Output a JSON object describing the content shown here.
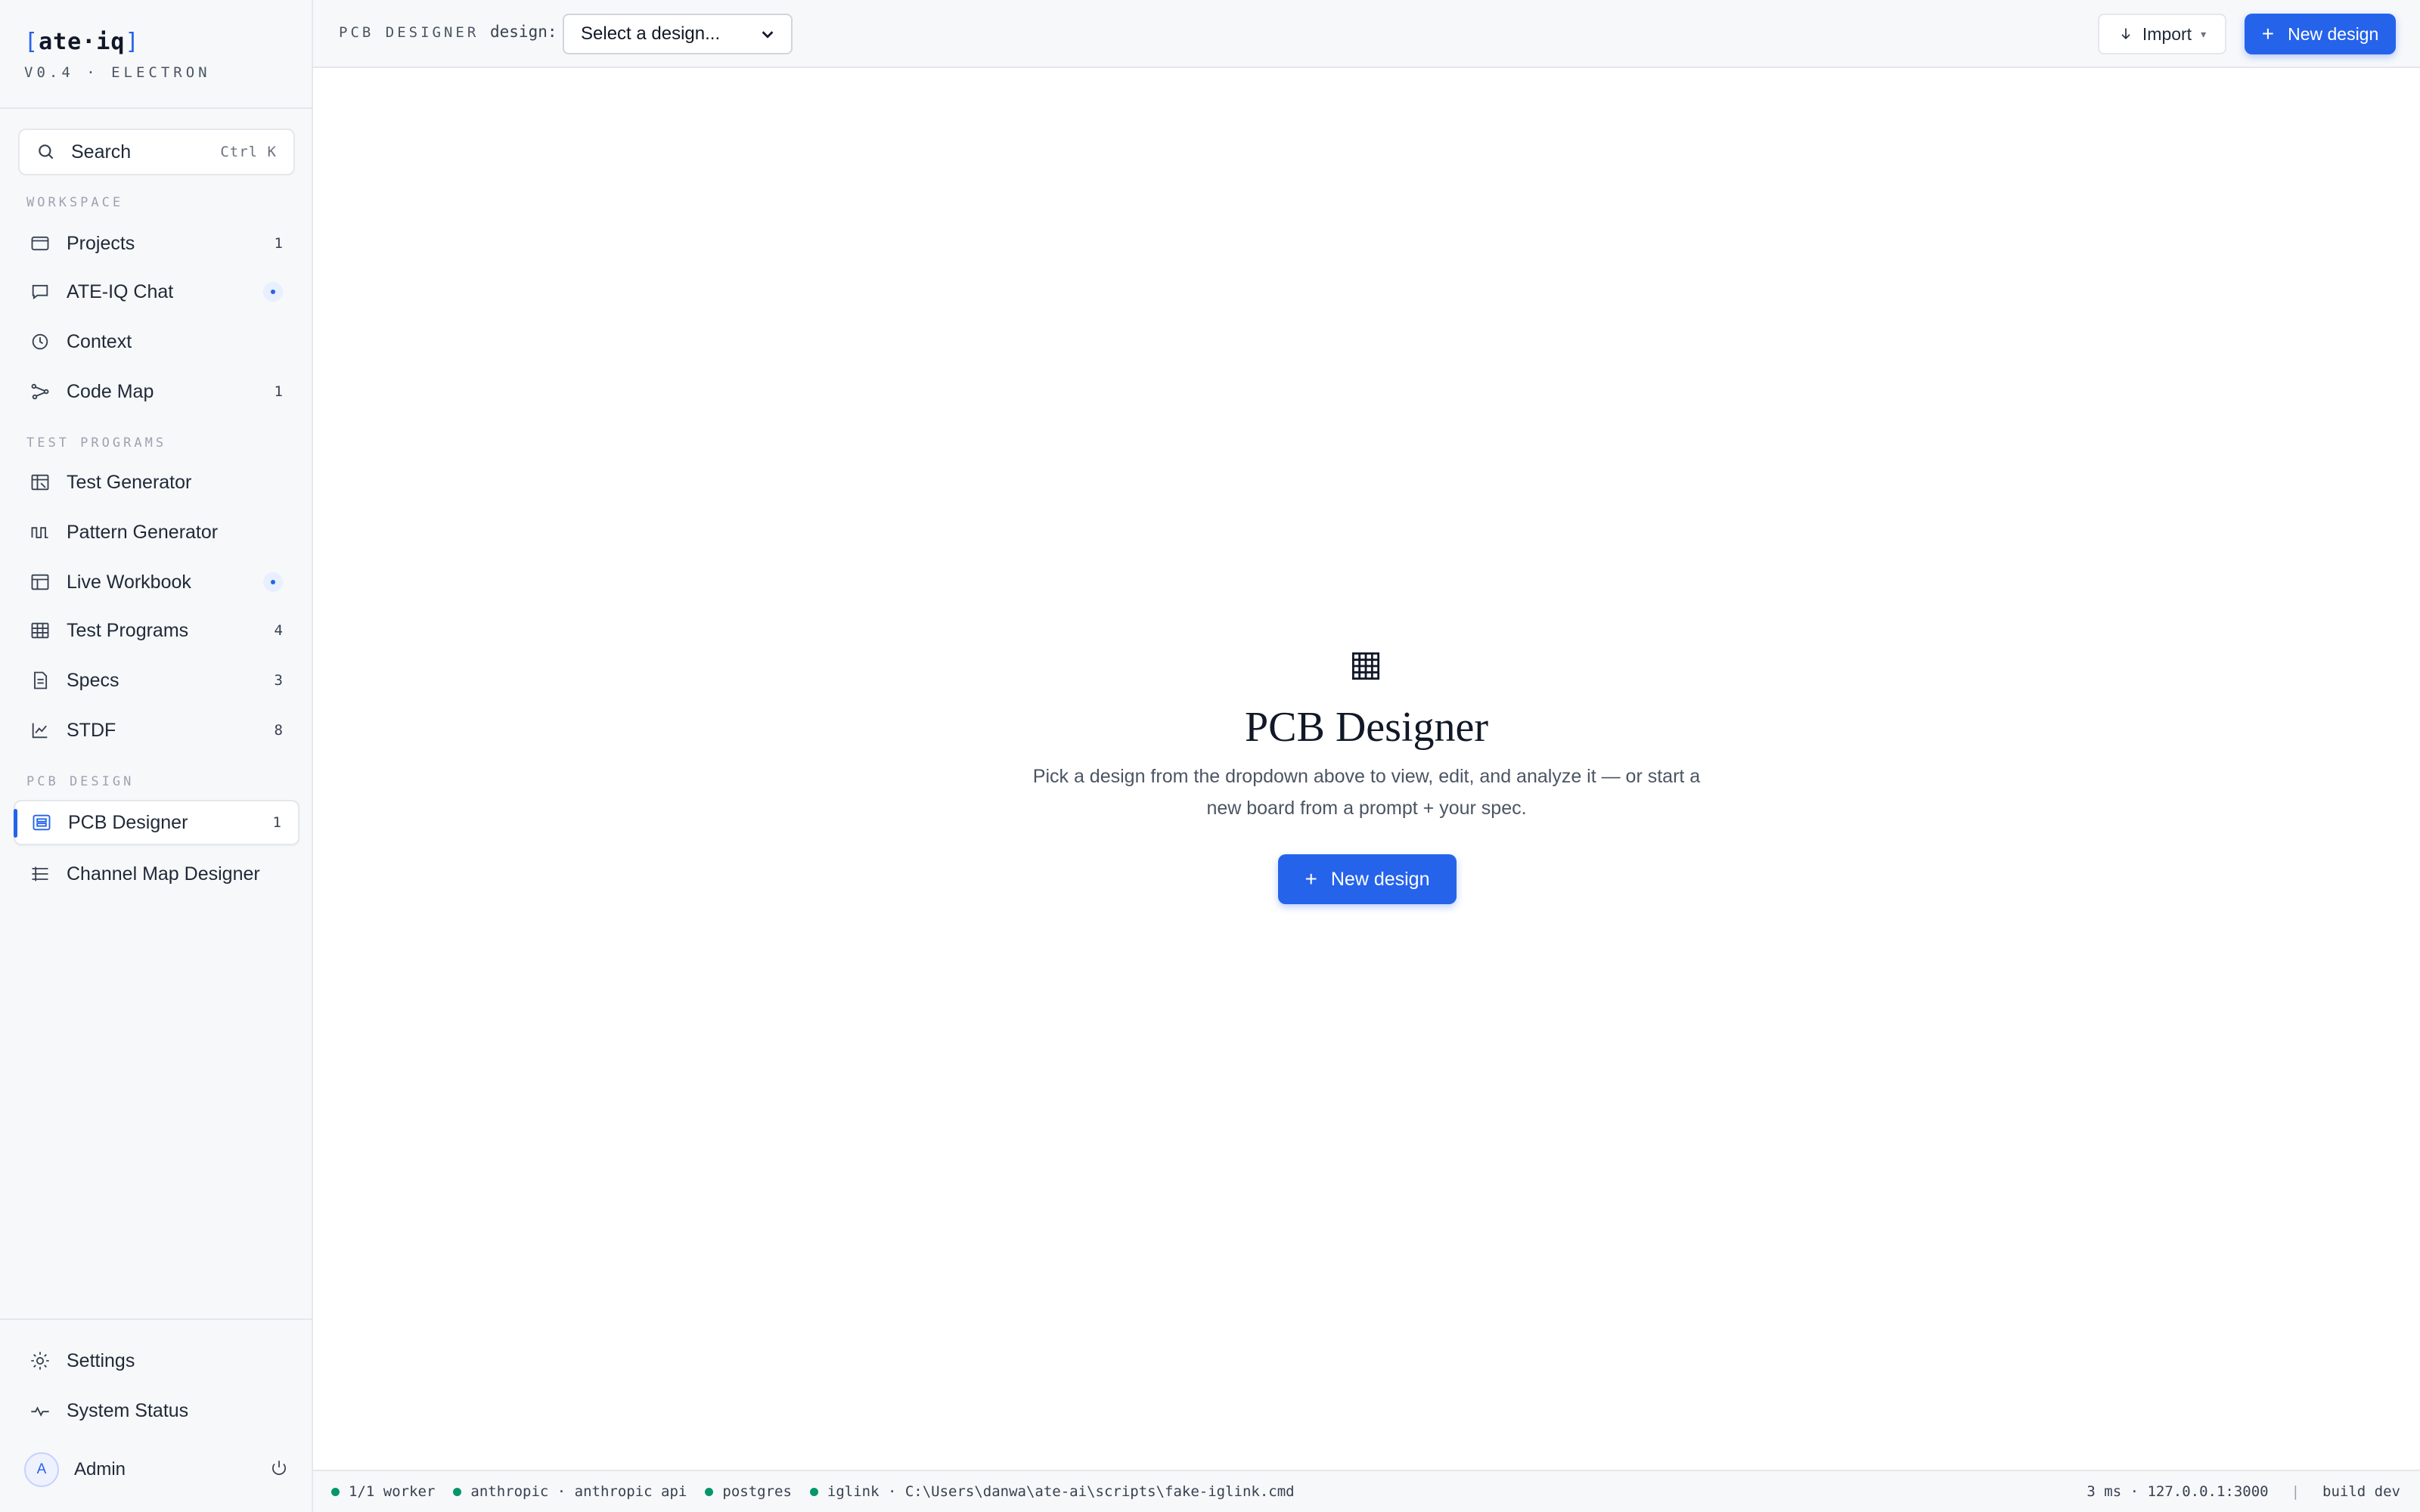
{
  "brand": {
    "logo_open": "[",
    "logo_text": "ate·iq",
    "logo_close": "]",
    "version": "V0.4 · ELECTRON"
  },
  "search": {
    "label": "Search",
    "shortcut": "Ctrl K",
    "icon": "search-icon"
  },
  "sidebar": {
    "sections": {
      "workspace": "WORKSPACE",
      "test_programs": "TEST PROGRAMS",
      "pcb_design": "PCB DESIGN"
    },
    "items": [
      {
        "label": "Projects",
        "count": "1",
        "icon": "folder-icon"
      },
      {
        "label": "ATE-IQ Chat",
        "count": "",
        "icon": "chat-icon",
        "dot": true
      },
      {
        "label": "Context",
        "count": "",
        "icon": "clock-icon"
      },
      {
        "label": "Code Map",
        "count": "1",
        "icon": "graph-icon"
      },
      {
        "label": "Test Generator",
        "count": "",
        "icon": "flask-icon"
      },
      {
        "label": "Pattern Generator",
        "count": "",
        "icon": "waveform-icon"
      },
      {
        "label": "Live Workbook",
        "count": "",
        "icon": "table-icon",
        "dot": true
      },
      {
        "label": "Test Programs",
        "count": "4",
        "icon": "grid-icon"
      },
      {
        "label": "Specs",
        "count": "3",
        "icon": "document-icon"
      },
      {
        "label": "STDF",
        "count": "8",
        "icon": "line-chart-icon"
      },
      {
        "label": "PCB Designer",
        "count": "1",
        "icon": "board-icon",
        "active": true
      },
      {
        "label": "Channel Map Designer",
        "count": "",
        "icon": "channel-map-icon"
      }
    ],
    "footer": {
      "settings": "Settings",
      "system_status": "System Status",
      "user_initial": "A",
      "user_name": "Admin"
    }
  },
  "topbar": {
    "crumb": "PCB DESIGNER",
    "design_label": "design:",
    "design_select_value": "Select a design...",
    "import_label": "Import",
    "new_design_label": "New design"
  },
  "empty_state": {
    "title": "PCB Designer",
    "description": "Pick a design from the dropdown above to view, edit, and analyze it — or start a new board from a prompt + your spec.",
    "button_label": "New design"
  },
  "status_bar": {
    "items": [
      "1/1 worker",
      "anthropic · anthropic api",
      "postgres",
      "iglink · C:\\Users\\danwa\\ate-ai\\scripts\\fake-iglink.cmd"
    ],
    "latency": "3 ms · 127.0.0.1:3000",
    "separator": "|",
    "build": "build dev"
  },
  "colors": {
    "accent": "#2563eb",
    "status_ok": "#059669",
    "sidebar_bg": "#f7f8fa"
  }
}
